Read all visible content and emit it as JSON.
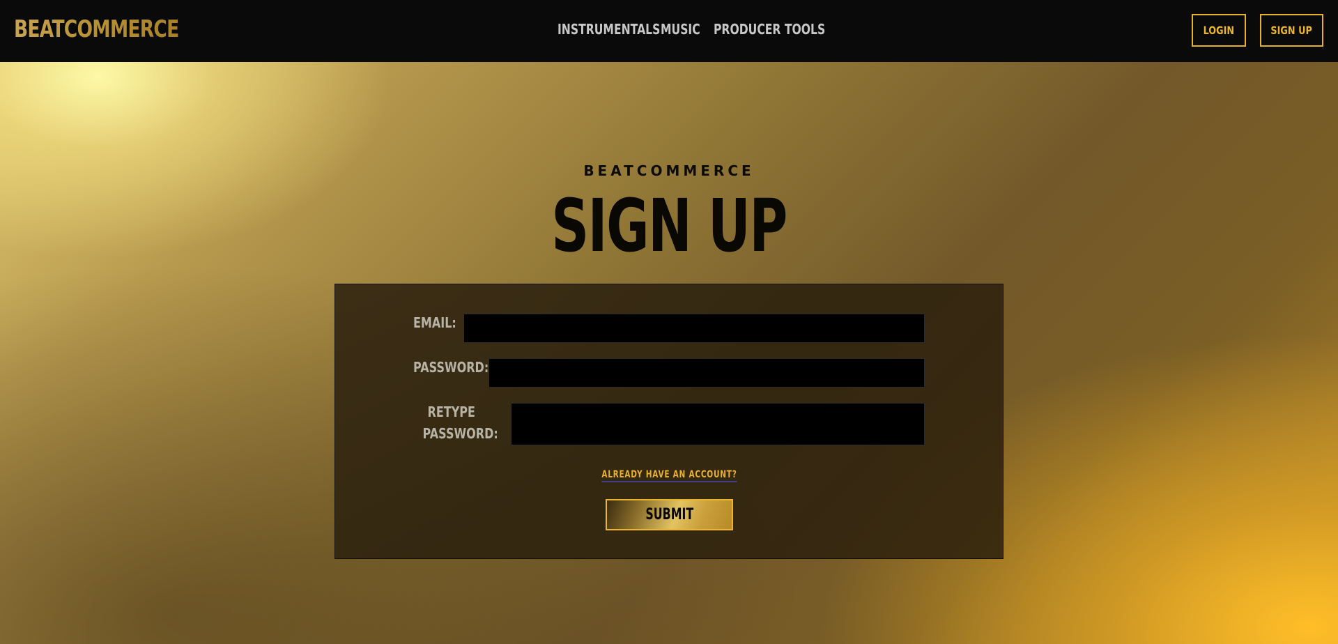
{
  "header": {
    "logo": "BEATCOMMERCE",
    "nav": [
      "INSTRUMENTALS",
      "MUSIC",
      "PRODUCER TOOLS"
    ],
    "login_label": "LOGIN",
    "signup_label": "SIGN UP"
  },
  "hero": {
    "brand": "BEATCOMMERCE",
    "title": "SIGN UP"
  },
  "form": {
    "email_label": "EMAIL:",
    "email_value": "",
    "password_label": "PASSWORD:",
    "password_value": "",
    "retype_label_line1": "RETYPE",
    "retype_label_line2": "PASSWORD:",
    "retype_value": "",
    "already_link": "ALREADY HAVE AN ACCOUNT?",
    "submit_label": "SUBMIT"
  },
  "colors": {
    "accent": "#e8b52c",
    "header_bg": "#0a0a0a",
    "panel_bg": "#33260f",
    "input_bg": "#000000"
  }
}
